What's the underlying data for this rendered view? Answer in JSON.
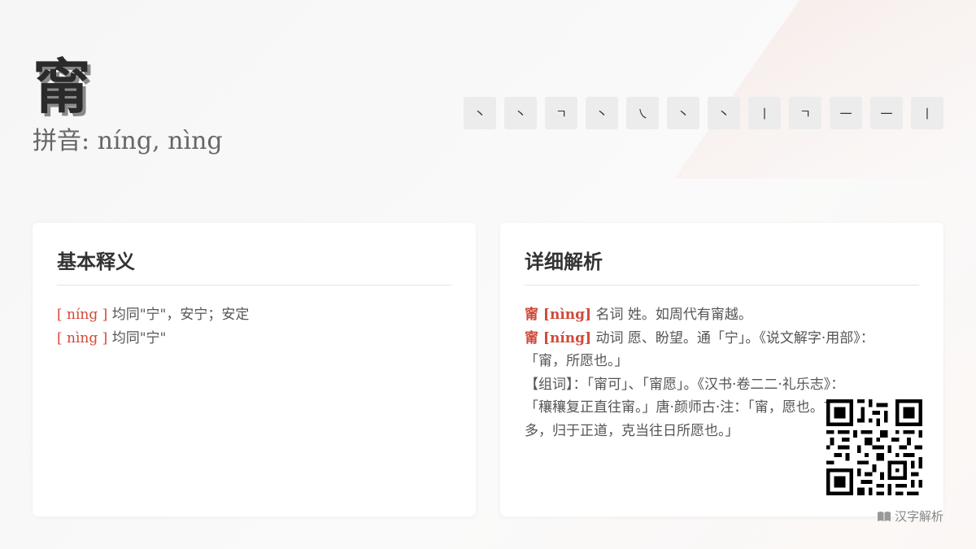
{
  "header": {
    "character": "甯",
    "pinyin_label": "拼音: níng, nìng"
  },
  "strokes": [
    "丶",
    "丶",
    "ㄱ",
    "丶",
    "㇏",
    "丶",
    "丶",
    "丨",
    "ㄱ",
    "一",
    "一",
    "丨"
  ],
  "basic": {
    "title": "基本释义",
    "entries": [
      {
        "pron": "[ níng ]",
        "text": " 均同\"宁\"，安宁；安定"
      },
      {
        "pron": "[ nìng ]",
        "text": " 均同\"宁\""
      }
    ]
  },
  "detail": {
    "title": "详细解析",
    "l1_head": "甯 [nìng]",
    "l1_text": " 名词 姓。如周代有甯越。",
    "l2_head": "甯 [níng]",
    "l2_text": " 动词 愿、盼望。通「宁」。《说文解字·用部》：",
    "l3": "「甯，所愿也。」",
    "l4": "【组词】：「甯可」、「甯愿」。《汉书·卷二二·礼乐志》：",
    "l5": "「穰穰复正直往甯。」唐·颜师古·注：「甯，愿也。言福禄既",
    "l6": "多，归于正道，克当往日所愿也。」"
  },
  "footer": {
    "brand": "汉字解析"
  },
  "colors": {
    "accent": "#d04a3a"
  }
}
